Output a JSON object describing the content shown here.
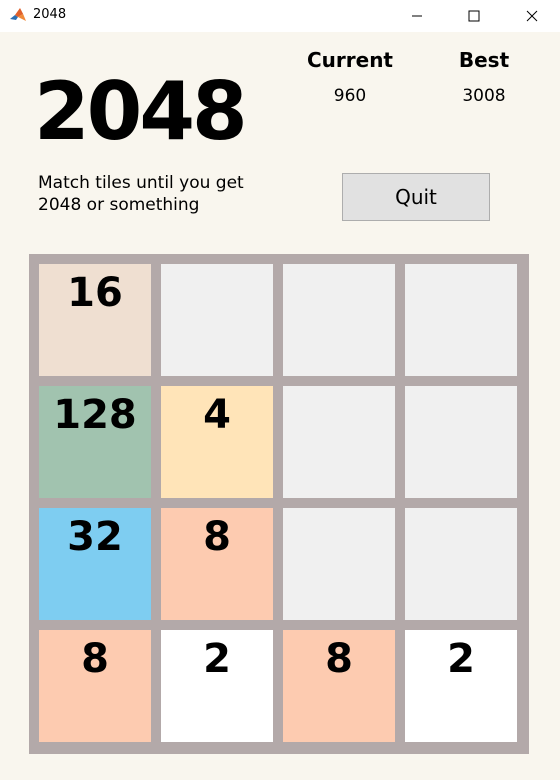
{
  "window": {
    "title": "2048",
    "icon": "matlab-logo-icon",
    "controls": [
      "minimize-icon",
      "maximize-icon",
      "close-icon"
    ]
  },
  "header": {
    "title": "2048",
    "subtitle": "Match tiles until you get 2048 or something"
  },
  "scores": {
    "current_label": "Current",
    "current_value": "960",
    "best_label": "Best",
    "best_value": "3008"
  },
  "controls": {
    "quit_label": "Quit"
  },
  "colors": {
    "background": "#f9f6ee",
    "board": "#b3a9a9",
    "empty": "#f0f0f0",
    "tile_2": "#ffffff",
    "tile_4": "#ffe4b8",
    "tile_8": "#fdcbb0",
    "tile_16": "#efdfd1",
    "tile_32": "#7ecdf1",
    "tile_128": "#a1c3af"
  },
  "board": {
    "rows": [
      [
        "16",
        "",
        "",
        ""
      ],
      [
        "128",
        "4",
        "",
        ""
      ],
      [
        "32",
        "8",
        "",
        ""
      ],
      [
        "8",
        "2",
        "8",
        "2"
      ]
    ]
  }
}
